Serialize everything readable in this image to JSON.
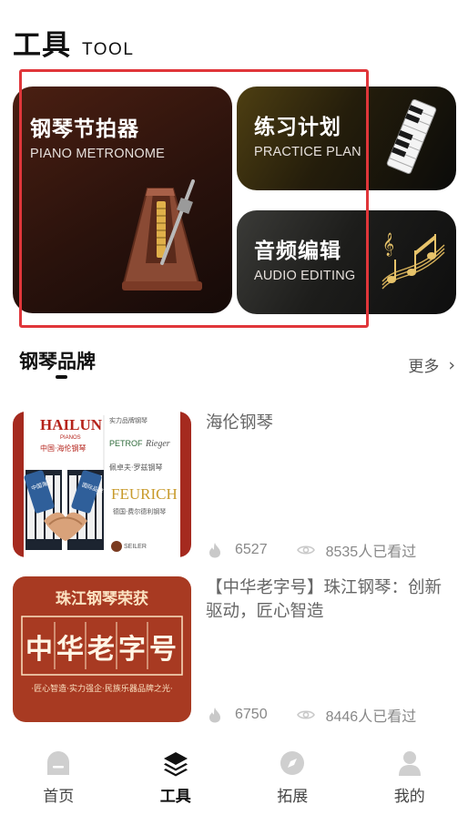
{
  "header": {
    "title": "工具",
    "subtitle": "TOOL"
  },
  "tools": {
    "metronome": {
      "title": "钢琴节拍器",
      "subtitle": "PIANO METRONOME",
      "icon": "metronome-icon"
    },
    "practice": {
      "title": "练习计划",
      "subtitle": "PRACTICE PLAN",
      "icon": "piano-keys-icon"
    },
    "audio": {
      "title": "音频编辑",
      "subtitle": "AUDIO EDITING",
      "icon": "music-notes-icon"
    }
  },
  "section": {
    "title": "钢琴品牌",
    "more_label": "更多"
  },
  "articles": [
    {
      "title": "海伦钢琴",
      "likes": "6527",
      "views": "8535人已看过",
      "thumb": {
        "brand": "HAILUN",
        "brand_sub": "PIANOS",
        "cn": "中国·海伦钢琴",
        "right_top": "实力品牌钢琴",
        "petrof": "PETROF",
        "rieger": "Rieger",
        "mid": "佩卓夫·罗兹钢琴",
        "feurich": "FEURICH",
        "feurich_cn": "德国·费尔德利钢琴",
        "seiler": "SEILER",
        "left_banner": "中国海伦",
        "right_banner": "国际品牌"
      }
    },
    {
      "title": "【中华老字号】珠江钢琴：创新驱动，匠心智造",
      "likes": "6750",
      "views": "8446人已看过",
      "thumb": {
        "top": "珠江钢琴荣获",
        "big": [
          "中",
          "华",
          "老",
          "字",
          "号"
        ],
        "bottom": "·匠心智造·实力强企·民族乐器品牌之光·"
      }
    }
  ],
  "tabbar": [
    {
      "label": "首页",
      "icon": "home-icon",
      "active": false
    },
    {
      "label": "工具",
      "icon": "layers-icon",
      "active": true
    },
    {
      "label": "拓展",
      "icon": "compass-icon",
      "active": false
    },
    {
      "label": "我的",
      "icon": "user-icon",
      "active": false
    }
  ],
  "colors": {
    "highlight": "#e0363a",
    "thumb_red": "#a52a1f"
  }
}
